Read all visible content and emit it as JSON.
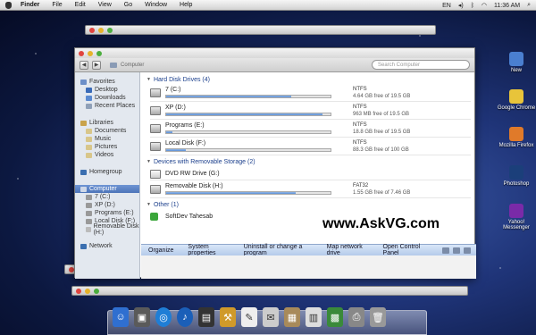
{
  "menubar": {
    "app": "Finder",
    "items": [
      "File",
      "Edit",
      "View",
      "Go",
      "Window",
      "Help"
    ],
    "right": {
      "lang": "EN",
      "time": "11:36 AM"
    }
  },
  "window": {
    "breadcrumb": "Computer",
    "search_placeholder": "Search Computer",
    "sidebar": {
      "favorites": {
        "label": "Favorites",
        "items": [
          "Desktop",
          "Downloads",
          "Recent Places"
        ]
      },
      "libraries": {
        "label": "Libraries",
        "items": [
          "Documents",
          "Music",
          "Pictures",
          "Videos"
        ]
      },
      "homegroup": "Homegroup",
      "computer": {
        "label": "Computer",
        "items": [
          "7 (C:)",
          "XP (D:)",
          "Programs (E:)",
          "Local Disk (F:)",
          "Removable Disk (H:)"
        ]
      },
      "network": "Network"
    },
    "sections": {
      "hdd": "Hard Disk Drives (4)",
      "removable": "Devices with Removable Storage (2)",
      "other": "Other (1)"
    },
    "drives": [
      {
        "name": "7 (C:)",
        "fs": "NTFS",
        "free": "4.64 GB free of 19.5 GB",
        "used": 0.76
      },
      {
        "name": "XP (D:)",
        "fs": "NTFS",
        "free": "963 MB free of 19.5 GB",
        "used": 0.95
      },
      {
        "name": "Programs (E:)",
        "fs": "NTFS",
        "free": "18.8 GB free of 19.5 GB",
        "used": 0.04
      },
      {
        "name": "Local Disk (F:)",
        "fs": "NTFS",
        "free": "88.3 GB free of 100 GB",
        "used": 0.12
      }
    ],
    "removable": [
      {
        "name": "DVD RW Drive (G:)"
      },
      {
        "name": "Removable Disk (H:)",
        "fs": "FAT32",
        "free": "1.55 GB free of 7.46 GB",
        "used": 0.79
      }
    ],
    "other_item": "SoftDev Tahesab",
    "commands": [
      "Organize",
      "System properties",
      "Uninstall or change a program",
      "Map network drive",
      "Open Control Panel"
    ]
  },
  "watermark": "www.AskVG.com",
  "desktop_icons": [
    {
      "label": "New",
      "color": "#4a7fd0",
      "icon": "folder-icon"
    },
    {
      "label": "Google Chrome",
      "color": "#e8c43a",
      "icon": "chrome-icon"
    },
    {
      "label": "Mozilla Firefox",
      "color": "#e07a2a",
      "icon": "firefox-icon"
    },
    {
      "label": "Photoshop",
      "color": "#1b3f7a",
      "icon": "photoshop-icon"
    },
    {
      "label": "Yahoo! Messenger",
      "color": "#7a2aa8",
      "icon": "yahoo-icon"
    }
  ]
}
